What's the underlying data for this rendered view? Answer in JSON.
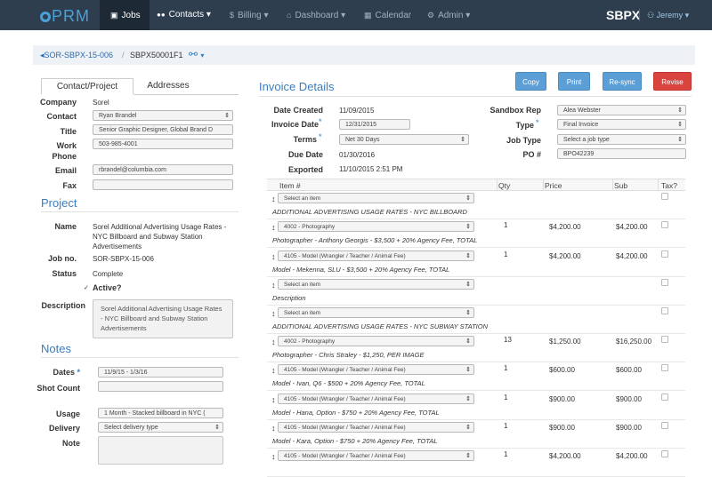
{
  "nav": {
    "logo": "PRM",
    "items": [
      {
        "icon": "▣",
        "label": "Jobs"
      },
      {
        "icon": "👥",
        "label": "Contacts",
        "caret": "▾"
      },
      {
        "icon": "$",
        "label": "Billing",
        "caret": "▾"
      },
      {
        "icon": "⌂",
        "label": "Dashboard",
        "caret": "▾"
      },
      {
        "icon": "▦",
        "label": "Calendar"
      },
      {
        "icon": "⚙",
        "label": "Admin",
        "caret": "▾"
      }
    ],
    "brand": "SBPX",
    "user": "Jeremy"
  },
  "breadcrumb": {
    "back": "SOR-SBPX-15-006",
    "sep": "/",
    "current": "SBPX50001F1"
  },
  "tabs": {
    "contact": "Contact/Project",
    "addresses": "Addresses"
  },
  "contact": {
    "company_label": "Company",
    "company": "Sorel",
    "contact_label": "Contact",
    "contact": "Ryan Brandel",
    "title_label": "Title",
    "title": "Senior Graphic Designer, Global Brand D",
    "work_phone_label": "Work Phone",
    "work_phone": "503-985-4001",
    "email_label": "Email",
    "email": "rbrandel@columbia.com",
    "fax_label": "Fax",
    "fax": ""
  },
  "project": {
    "heading": "Project",
    "name_label": "Name",
    "name": "Sorel Additional Advertising Usage Rates - NYC Billboard and Subway Station Advertisements",
    "jobno_label": "Job no.",
    "jobno": "SOR-SBPX-15-006",
    "status_label": "Status",
    "status": "Complete",
    "active_label": "Active?",
    "description_label": "Description",
    "description": "Sorel Additional Advertising Usage Rates - NYC Billboard and Subway Station Advertisements"
  },
  "notes": {
    "heading": "Notes",
    "dates_label": "Dates",
    "dates": "11/9/15 - 1/3/16",
    "shot_count_label": "Shot Count",
    "shot_count": "",
    "usage_label": "Usage",
    "usage": "1 Month - Stacked billboard in NYC (",
    "delivery_label": "Delivery",
    "delivery": "Select delivery type",
    "note_label": "Note",
    "note": ""
  },
  "invoice": {
    "heading": "Invoice Details",
    "buttons": {
      "copy": "Copy",
      "print": "Print",
      "resync": "Re-sync",
      "revise": "Revise"
    },
    "date_created_label": "Date Created",
    "date_created": "11/09/2015",
    "invoice_date_label": "Invoice Date",
    "invoice_date": "12/31/2015",
    "terms_label": "Terms",
    "terms": "Net 30 Days",
    "due_date_label": "Due Date",
    "due_date": "01/30/2016",
    "exported_label": "Exported",
    "exported": "11/10/2015 2:51 PM",
    "rep_label": "Sandbox Rep",
    "rep": "Alea Webster",
    "type_label": "Type",
    "type": "Final Invoice",
    "job_type_label": "Job Type",
    "job_type": "Select a job type",
    "po_label": "PO #",
    "po": "BPO42239"
  },
  "table": {
    "headers": {
      "item": "Item #",
      "qty": "Qty",
      "price": "Price",
      "sub": "Sub",
      "tax": "Tax?"
    },
    "rows": [
      {
        "item": "Select an item",
        "qty": "",
        "price": "",
        "sub": "",
        "desc": "ADDITIONAL ADVERTISING USAGE RATES - NYC BILLBOARD"
      },
      {
        "item": "4002 - Photography",
        "qty": "1",
        "price": "$4,200.00",
        "sub": "$4,200.00",
        "desc": "Photographer - Anthony Georgis - $3,500 + 20% Agency Fee, TOTAL"
      },
      {
        "item": "4105 - Model (Wrangler / Teacher / Animal Fee)",
        "qty": "1",
        "price": "$4,200.00",
        "sub": "$4,200.00",
        "desc": "Model - Mekenna, SLU - $3,500 + 20% Agency Fee, TOTAL"
      },
      {
        "item": "Select an item",
        "qty": "",
        "price": "",
        "sub": "",
        "desc": "Description"
      },
      {
        "item": "Select an item",
        "qty": "",
        "price": "",
        "sub": "",
        "desc": "ADDITIONAL ADVERTISING USAGE RATES - NYC SUBWAY STATION"
      },
      {
        "item": "4002 - Photography",
        "qty": "13",
        "price": "$1,250.00",
        "sub": "$16,250.00",
        "desc": "Photographer - Chris Straley - $1,250, PER IMAGE"
      },
      {
        "item": "4105 - Model (Wrangler / Teacher / Animal Fee)",
        "qty": "1",
        "price": "$600.00",
        "sub": "$600.00",
        "desc": "Model - Ivan, Q6 - $500 + 20% Agency Fee, TOTAL"
      },
      {
        "item": "4105 - Model (Wrangler / Teacher / Animal Fee)",
        "qty": "1",
        "price": "$900.00",
        "sub": "$900.00",
        "desc": "Model - Hana, Option - $750 + 20% Agency Fee, TOTAL"
      },
      {
        "item": "4105 - Model (Wrangler / Teacher / Animal Fee)",
        "qty": "1",
        "price": "$900.00",
        "sub": "$900.00",
        "desc": "Model - Kara, Option - $750 + 20% Agency Fee, TOTAL"
      },
      {
        "item": "4105 - Model (Wrangler / Teacher / Animal Fee)",
        "qty": "1",
        "price": "$4,200.00",
        "sub": "$4,200.00",
        "desc": ""
      }
    ]
  }
}
